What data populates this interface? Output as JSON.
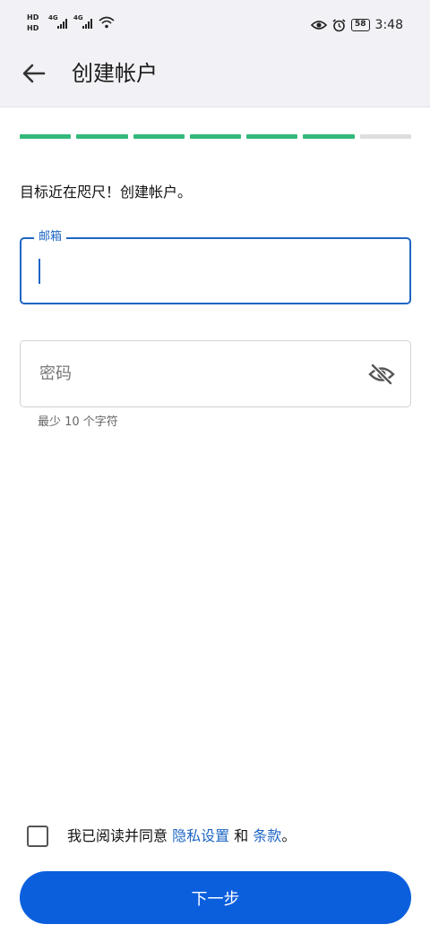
{
  "status_bar": {
    "sim1": "HD",
    "sim2": "HD",
    "net1": "4G",
    "net2": "4G",
    "battery": "58",
    "time": "3:48"
  },
  "app_bar": {
    "title": "创建帐户",
    "back_icon": "arrow-left-icon"
  },
  "progress": {
    "total_steps": 7,
    "completed_steps": 6,
    "done_color": "#34b97a",
    "todo_color": "#dedede"
  },
  "intro_text": "目标近在咫尺！创建帐户。",
  "email_field": {
    "label": "邮箱",
    "value": ""
  },
  "password_field": {
    "placeholder": "密码",
    "value": "",
    "toggle_icon": "eye-off-icon",
    "helper": "最少 10 个字符"
  },
  "agreement": {
    "prefix": "我已阅读并同意 ",
    "privacy_link": "隐私设置",
    "joiner": " 和 ",
    "terms_link": "条款",
    "suffix": "。",
    "checked": false
  },
  "next_button": {
    "label": "下一步",
    "color": "#0b5fdd"
  },
  "accent_color": "#1e66c4"
}
